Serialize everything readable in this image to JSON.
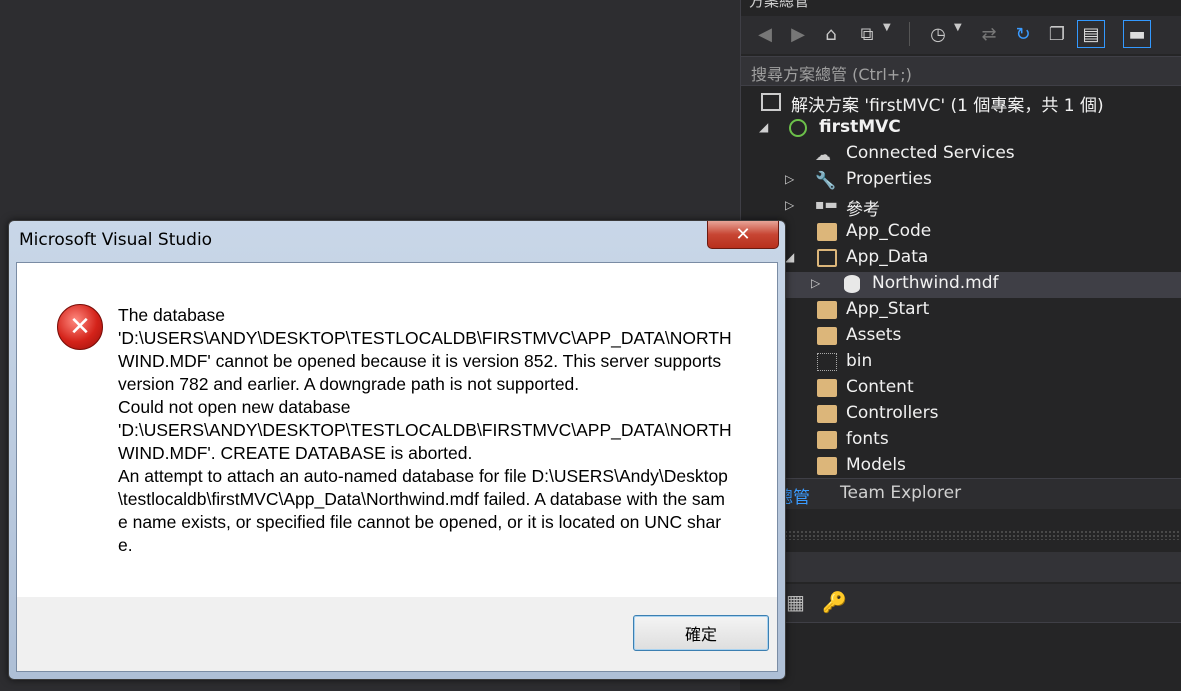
{
  "solution_explorer": {
    "pane_title": "方案總管",
    "search_placeholder": "搜尋方案總管 (Ctrl+;)",
    "tree": [
      {
        "label": "解決方案 'firstMVC' (1 個專案，共 1 個)",
        "icon": "solution-icon"
      },
      {
        "label": "firstMVC",
        "icon": "web-project-icon"
      },
      {
        "label": "Connected Services",
        "icon": "cloud-icon"
      },
      {
        "label": "Properties",
        "icon": "wrench-icon"
      },
      {
        "label": "參考",
        "icon": "references-icon"
      },
      {
        "label": "App_Code",
        "icon": "folder-icon"
      },
      {
        "label": "App_Data",
        "icon": "folder-open-icon"
      },
      {
        "label": "Northwind.mdf",
        "icon": "database-icon"
      },
      {
        "label": "App_Start",
        "icon": "folder-icon"
      },
      {
        "label": "Assets",
        "icon": "folder-icon"
      },
      {
        "label": "bin",
        "icon": "bin-folder-icon"
      },
      {
        "label": "Content",
        "icon": "folder-icon"
      },
      {
        "label": "Controllers",
        "icon": "folder-icon"
      },
      {
        "label": "fonts",
        "icon": "folder-icon"
      },
      {
        "label": "Models",
        "icon": "folder-icon"
      }
    ],
    "tabs": [
      "總管",
      "Team Explorer"
    ]
  },
  "dialog": {
    "title": "Microsoft Visual Studio",
    "close_label": "✕",
    "message": "The database\n'D:\\USERS\\ANDY\\DESKTOP\\TESTLOCALDB\\FIRSTMVC\\APP_DATA\\NORTHWIND.MDF' cannot be opened because it is version 852. This server supports version 782 and earlier. A downgrade path is not supported.\nCould not open new database\n'D:\\USERS\\ANDY\\DESKTOP\\TESTLOCALDB\\FIRSTMVC\\APP_DATA\\NORTHWIND.MDF'. CREATE DATABASE is aborted.\nAn attempt to attach an auto-named database for file D:\\USERS\\Andy\\Desktop\\testlocaldb\\firstMVC\\App_Data\\Northwind.mdf failed. A database with the same name exists, or specified file cannot be opened, or it is located on UNC share.",
    "ok_label": "確定",
    "icon": "error-icon"
  },
  "colors": {
    "ide_bg": "#2d2d30",
    "pane_bg": "#252526",
    "accent": "#3a9bff",
    "error_red": "#d4231a"
  }
}
